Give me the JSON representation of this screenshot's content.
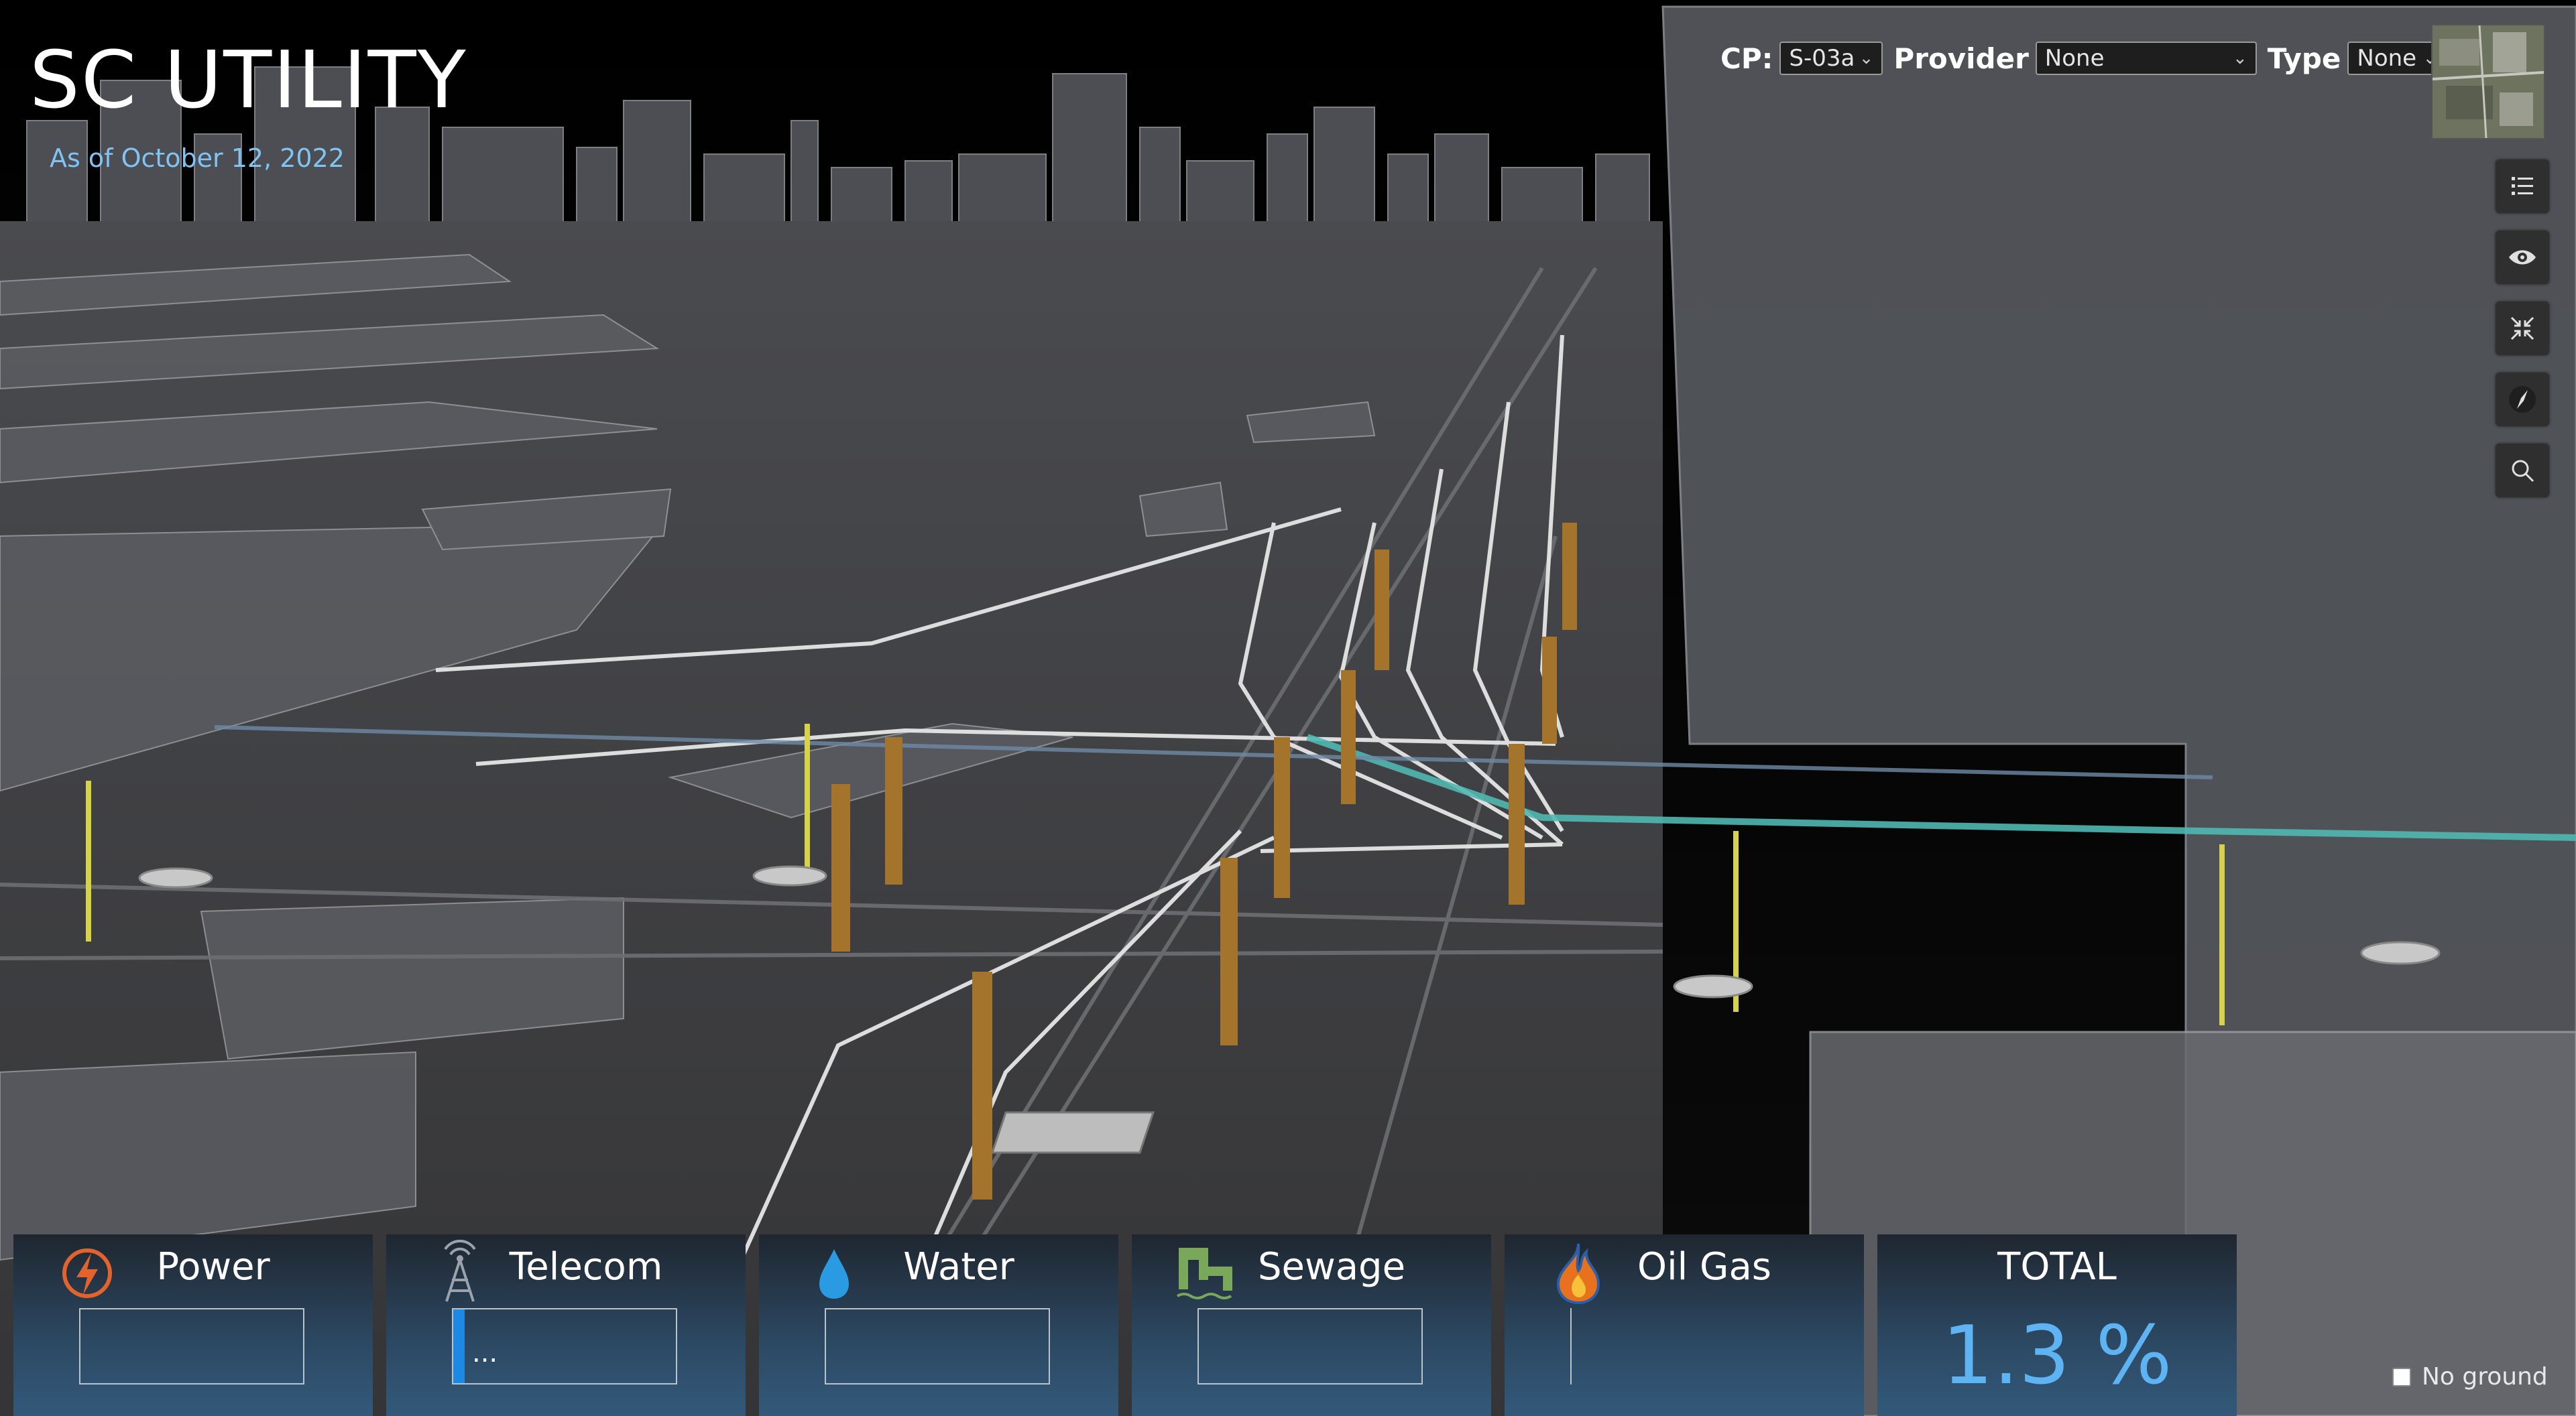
{
  "app": {
    "title": "SC UTILITY",
    "subtitle": "As of October 12, 2022"
  },
  "filters": {
    "cp_label": "CP:",
    "cp_value": "S-03a",
    "provider_label": "Provider",
    "provider_value": "None",
    "type_label": "Type",
    "type_value": "None"
  },
  "toolbar": {
    "buttons": [
      "list-icon",
      "eye-icon",
      "collapse-icon",
      "compass-icon",
      "search-icon"
    ]
  },
  "panels": [
    {
      "label": "Power",
      "icon": "lightning-icon",
      "progress": 0,
      "color": "#e2642c"
    },
    {
      "label": "Telecom",
      "icon": "antenna-tower-icon",
      "progress": 0.05,
      "loading": "...",
      "color": "#9aa3ab"
    },
    {
      "label": "Water",
      "icon": "water-drop-icon",
      "progress": 0,
      "color": "#2a9be3"
    },
    {
      "label": "Sewage",
      "icon": "sewage-pipe-icon",
      "progress": 0,
      "color": "#79a85a"
    },
    {
      "label": "Oil Gas",
      "icon": "flame-icon",
      "progress": 0,
      "color": "#f39c12"
    }
  ],
  "total": {
    "label": "TOTAL",
    "value": "1.3 %",
    "color": "#5eb4f2"
  },
  "no_ground": {
    "label": "No ground",
    "checked": false
  }
}
